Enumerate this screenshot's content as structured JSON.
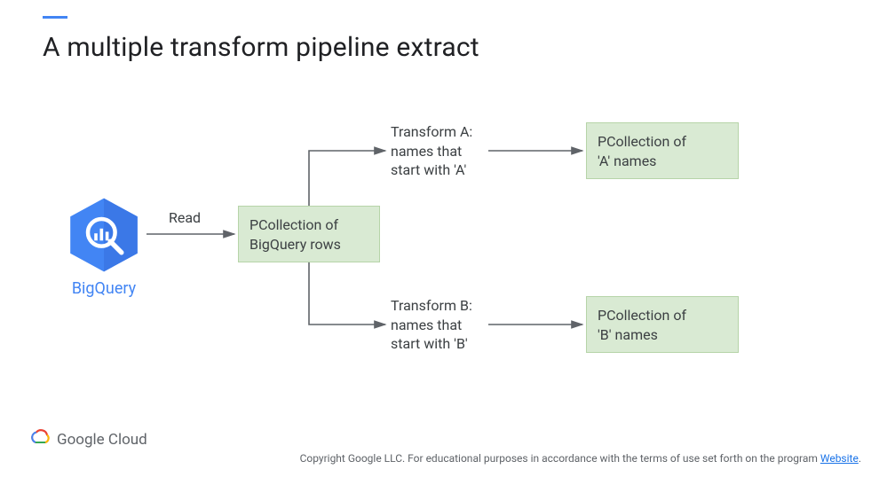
{
  "title": "A multiple transform pipeline extract",
  "diagram": {
    "source_label": "BigQuery",
    "read_label": "Read",
    "pcoll_input_l1": "PCollection of",
    "pcoll_input_l2": "BigQuery rows",
    "transform_a_l1": "Transform A:",
    "transform_a_l2": "names that",
    "transform_a_l3": "start with 'A'",
    "pcoll_a_l1": "PCollection of",
    "pcoll_a_l2": "'A' names",
    "transform_b_l1": "Transform B:",
    "transform_b_l2": "names that",
    "transform_b_l3": "start with 'B'",
    "pcoll_b_l1": "PCollection of",
    "pcoll_b_l2": "'B' names"
  },
  "footer": {
    "brand": "Google Cloud",
    "copyright_pre": "Copyright Google LLC. For educational purposes in accordance with the terms of use set forth on the program ",
    "website_link": "Website",
    "copyright_post": "."
  }
}
